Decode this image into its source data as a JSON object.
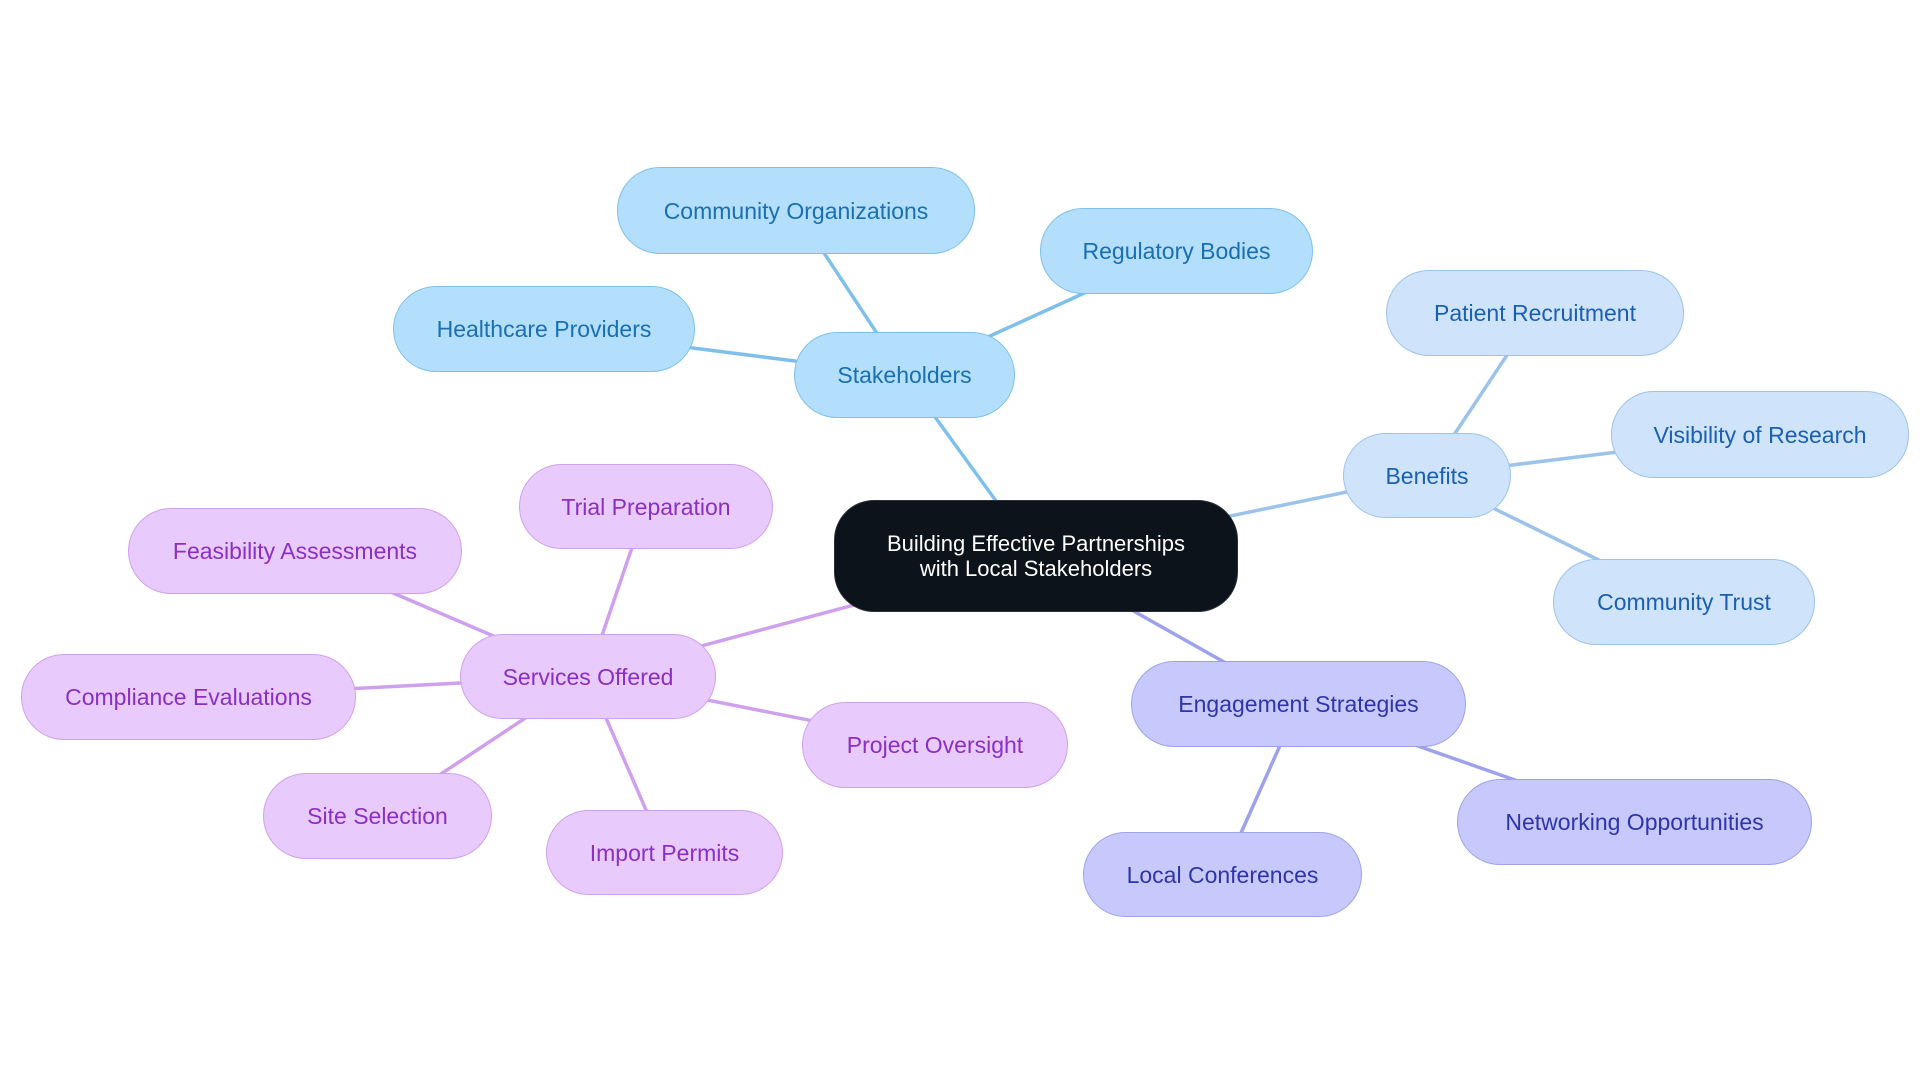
{
  "diagram": {
    "title": "Building Effective Partnerships\nwith Local Stakeholders",
    "root": {
      "id": "root",
      "label": "Building Effective Partnerships\nwith Local Stakeholders",
      "colors": {
        "fill": "#0d131a",
        "border": "#2a2f36",
        "text": "#ffffff"
      }
    },
    "branches": [
      {
        "id": "stakeholders",
        "label": "Stakeholders",
        "colors": {
          "fill": "#b3dffc",
          "border": "#7fc0ea",
          "text": "#1a6fb0",
          "edge": "#7fc0ea"
        },
        "children": [
          {
            "id": "community-organizations",
            "label": "Community Organizations"
          },
          {
            "id": "regulatory-bodies",
            "label": "Regulatory Bodies"
          },
          {
            "id": "healthcare-providers",
            "label": "Healthcare Providers"
          }
        ]
      },
      {
        "id": "benefits",
        "label": "Benefits",
        "colors": {
          "fill": "#cfe4fb",
          "border": "#9cc3ea",
          "text": "#1b5fb0",
          "edge": "#9cc3ea"
        },
        "children": [
          {
            "id": "patient-recruitment",
            "label": "Patient Recruitment"
          },
          {
            "id": "visibility-of-research",
            "label": "Visibility of Research"
          },
          {
            "id": "community-trust",
            "label": "Community Trust"
          }
        ]
      },
      {
        "id": "engagement-strategies",
        "label": "Engagement Strategies",
        "colors": {
          "fill": "#c7c9fc",
          "border": "#9ea2ea",
          "text": "#2f34a8",
          "edge": "#9ea2ea"
        },
        "children": [
          {
            "id": "local-conferences",
            "label": "Local Conferences"
          },
          {
            "id": "networking-opportunities",
            "label": "Networking Opportunities"
          }
        ]
      },
      {
        "id": "services-offered",
        "label": "Services Offered",
        "colors": {
          "fill": "#e8cbfc",
          "border": "#cfa0ec",
          "text": "#8a2fc0",
          "edge": "#cfa0ec"
        },
        "children": [
          {
            "id": "trial-preparation",
            "label": "Trial Preparation"
          },
          {
            "id": "feasibility-assessments",
            "label": "Feasibility Assessments"
          },
          {
            "id": "compliance-evaluations",
            "label": "Compliance Evaluations"
          },
          {
            "id": "site-selection",
            "label": "Site Selection"
          },
          {
            "id": "import-permits",
            "label": "Import Permits"
          },
          {
            "id": "project-oversight",
            "label": "Project Oversight"
          }
        ]
      }
    ]
  }
}
